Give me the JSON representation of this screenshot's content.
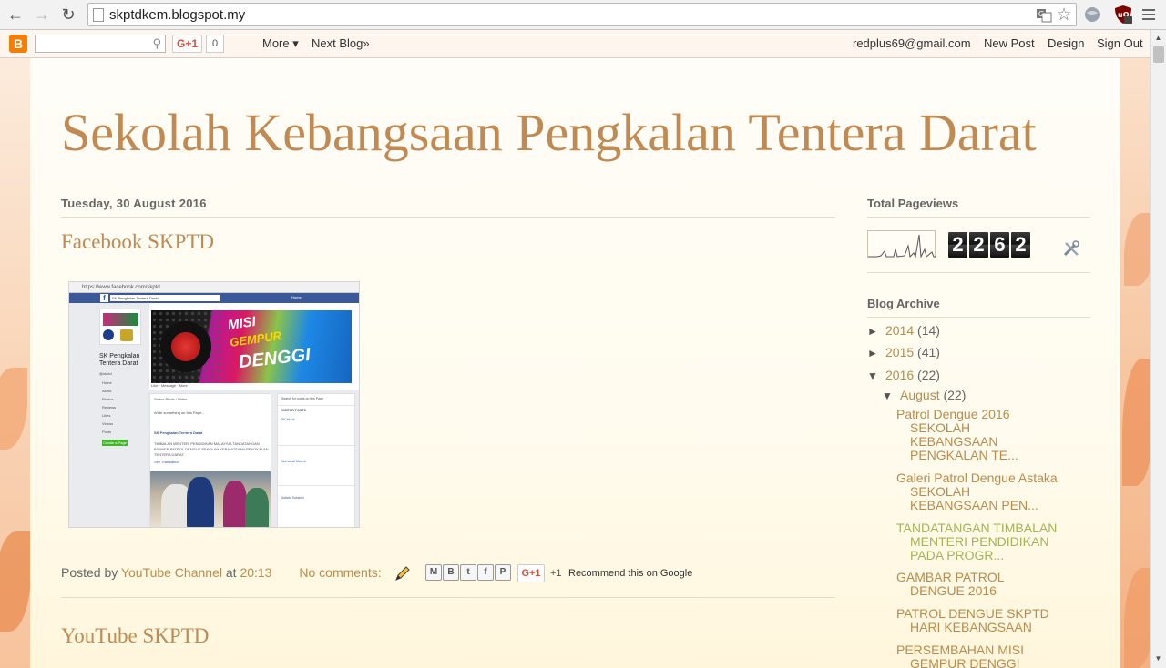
{
  "browser": {
    "url": "skptdkem.blogspot.my"
  },
  "navbar": {
    "gplus_label": "G+1",
    "gplus_count": "0",
    "more_label": "More ▾",
    "next_blog_label": "Next Blog»",
    "account_email": "redplus69@gmail.com",
    "new_post_label": "New Post",
    "design_label": "Design",
    "sign_out_label": "Sign Out"
  },
  "blog": {
    "title": "Sekolah Kebangsaan Pengkalan Tentera Darat"
  },
  "post": {
    "date": "Tuesday, 30 August 2016",
    "title": "Facebook SKPTD",
    "image": {
      "fb_url": "https://www.facebook.com/skptd",
      "fb_search": "SK Pengkalan Tentera Darat",
      "fb_home": "Home",
      "fb_page_name": "SK Pengkalan Tentera Darat",
      "fb_handle": "@skptd",
      "fb_menu": [
        "Home",
        "About",
        "Photos",
        "Reviews",
        "Likes",
        "Videos",
        "Posts"
      ],
      "fb_create_page": "Create a Page",
      "cover_misi": "MISI",
      "cover_gempur": "GEMPUR",
      "cover_denggi": "DENGGI",
      "cover_buttons": "Like · Message · More",
      "feed_status": "Status   Photo / Video",
      "feed_write": "Write something on this Page...",
      "feed_author": "SK Pengkalan Tentera Darat",
      "feed_text1": "TIMBALAN MENTERI PENDIDIKAN MALAYSIA TANDATANGAN",
      "feed_text2": "BANNER PATROL DENGUE SEKOLAH KEBANGSAAN PENGKALAN",
      "feed_text3": "TENTERA DARAT",
      "feed_see_translation": "See Translation",
      "side_search": "Search for posts on this Page",
      "side_visitor_posts": "VISITOR POSTS",
      "side_post1": "SK Murni",
      "side_post2": "Norhayati Marmit",
      "side_post3": "Asfaris Sukarmi"
    },
    "footer": {
      "posted_by": "Posted by",
      "author": "YouTube Channel",
      "at": "at",
      "time": "20:13",
      "comments": "No comments:",
      "plus_one": "+1",
      "recommend": "Recommend this on Google",
      "gplus_label": "G+1"
    },
    "next_title": "YouTube SKPTD"
  },
  "sidebar": {
    "pageviews": {
      "title": "Total Pageviews",
      "digits": [
        "2",
        "2",
        "6",
        "2"
      ]
    },
    "archive": {
      "title": "Blog Archive",
      "years": [
        {
          "arrow": "►",
          "year": "2014",
          "count": "(14)"
        },
        {
          "arrow": "►",
          "year": "2015",
          "count": "(41)"
        },
        {
          "arrow": "▼",
          "year": "2016",
          "count": "(22)"
        }
      ],
      "month": {
        "arrow": "▼",
        "name": "August",
        "count": "(22)"
      },
      "posts": [
        {
          "line1": "Patrol Dengue 2016",
          "line2": "SEKOLAH KEBANGSAAN PENGKALAN TE..."
        },
        {
          "line1": "Galeri Patrol Dengue Astaka",
          "line2": "SEKOLAH KEBANGSAAN PEN..."
        },
        {
          "line1": "TANDATANGAN TIMBALAN",
          "line2": "MENTERI PENDIDIKAN PADA PROGR..."
        },
        {
          "line1": "GAMBAR PATROL",
          "line2": "DENGUE 2016"
        },
        {
          "line1": "PATROL DENGUE SKPTD",
          "line2": "HARI KEBANGSAAN"
        },
        {
          "line1": "PERSEMBAHAN MISI",
          "line2": "GEMPUR DENGGI"
        }
      ]
    }
  },
  "colors": {
    "title": "#c08a52",
    "link": "#b98c4c",
    "visited_link": "#a3b55a"
  }
}
